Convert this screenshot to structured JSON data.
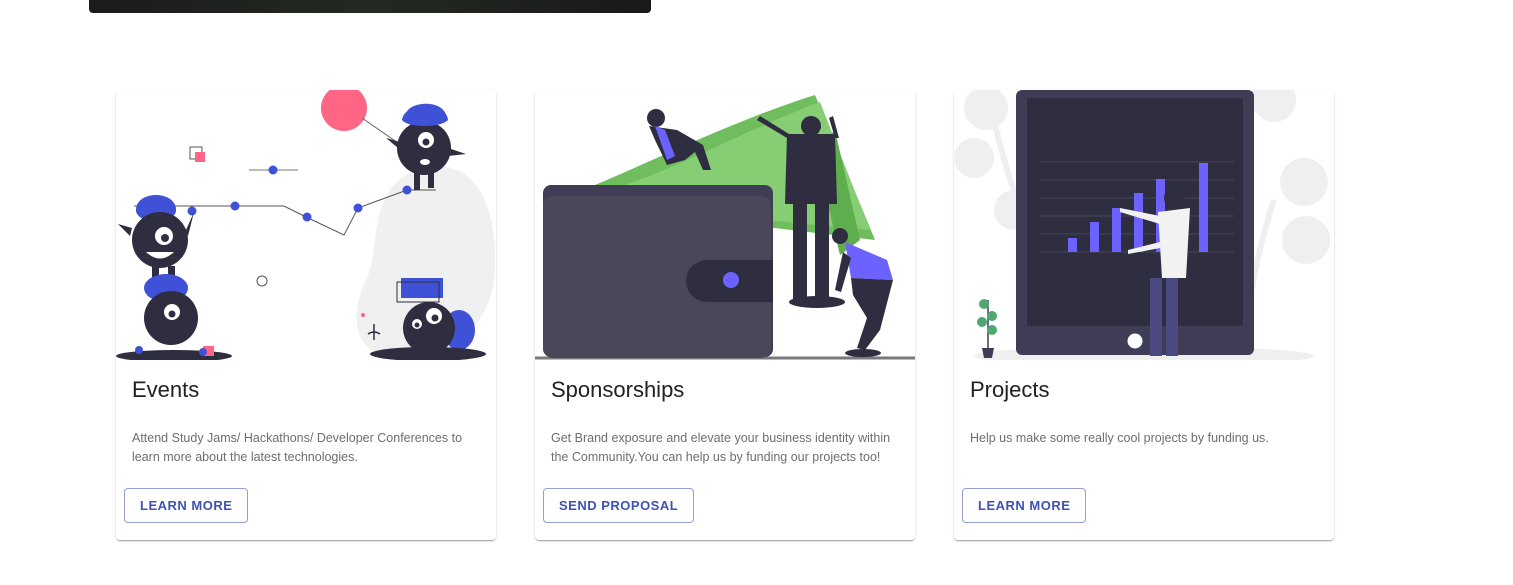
{
  "cards": [
    {
      "title": "Events",
      "description": "Attend Study Jams/ Hackathons/ Developer Conferences to learn more about the latest technologies.",
      "button": "LEARN MORE",
      "illustration": "monsters-graph-illustration"
    },
    {
      "title": "Sponsorships",
      "description": "Get Brand exposure and elevate your business identity within the Community.You can help us by funding our projects too!",
      "button": "SEND PROPOSAL",
      "illustration": "wallet-money-illustration"
    },
    {
      "title": "Projects",
      "description": "Help us make some really cool projects by funding us.",
      "button": "LEARN MORE",
      "illustration": "tablet-chart-illustration"
    }
  ],
  "colors": {
    "accent": "#3f51b5",
    "illustration_purple": "#6c63ff",
    "illustration_blue": "#3f51d6",
    "illustration_pink": "#ff6584",
    "money_green": "#7dc56a",
    "dark": "#2f2e41"
  }
}
